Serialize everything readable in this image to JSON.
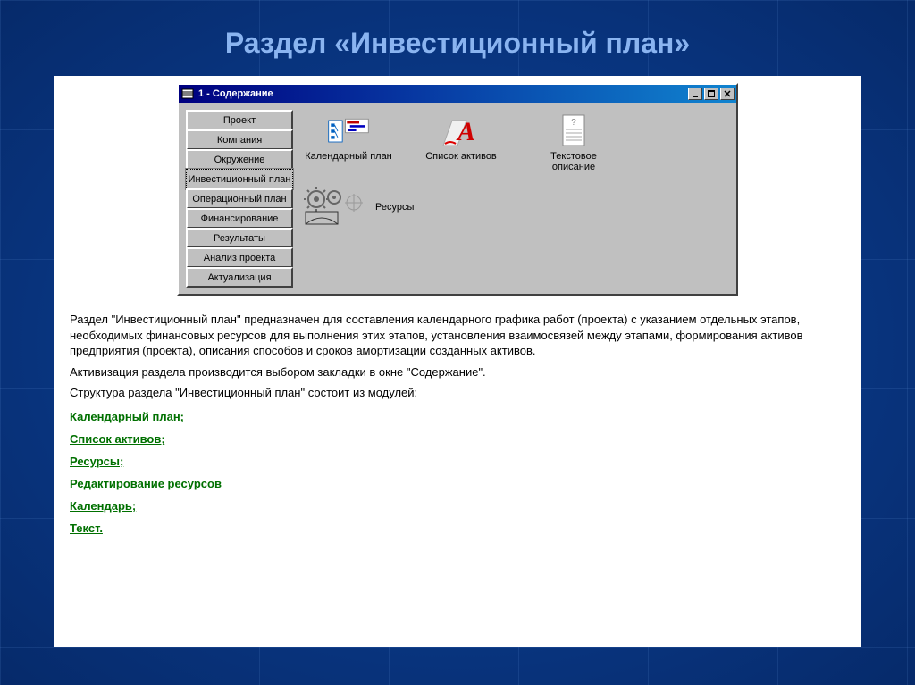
{
  "slide_title": "Раздел «Инвестиционный план»",
  "window": {
    "title": "1 - Содержание",
    "controls": {
      "min": "_",
      "max": "□",
      "close": "×"
    },
    "tabs": [
      {
        "label": "Проект",
        "active": false
      },
      {
        "label": "Компания",
        "active": false
      },
      {
        "label": "Окружение",
        "active": false
      },
      {
        "label": "Инвестиционный план",
        "active": true
      },
      {
        "label": "Операционный план",
        "active": false
      },
      {
        "label": "Финансирование",
        "active": false
      },
      {
        "label": "Результаты",
        "active": false
      },
      {
        "label": "Анализ проекта",
        "active": false
      },
      {
        "label": "Актуализация",
        "active": false
      }
    ],
    "modules": {
      "calendar": "Календарный план",
      "assets": "Список активов",
      "text_desc": "Текстовое описание",
      "resources": "Ресурсы"
    }
  },
  "description": {
    "p1": "Раздел \"Инвестиционный план\" предназначен для составления календарного графика работ (проекта) с указанием отдельных этапов, необходимых финансовых ресурсов для выполнения этих этапов, установления взаимосвязей между этапами, формирования активов предприятия (проекта), описания способов и сроков амортизации созданных активов.",
    "p2": "Активизация раздела производится выбором закладки в окне \"Содержание\".",
    "p3": "Структура раздела \"Инвестиционный план\"  состоит из модулей:"
  },
  "links": [
    "Календарный план;",
    "Список активов;",
    "Ресурсы;",
    "Редактирование ресурсов",
    "Календарь;",
    "Текст."
  ]
}
